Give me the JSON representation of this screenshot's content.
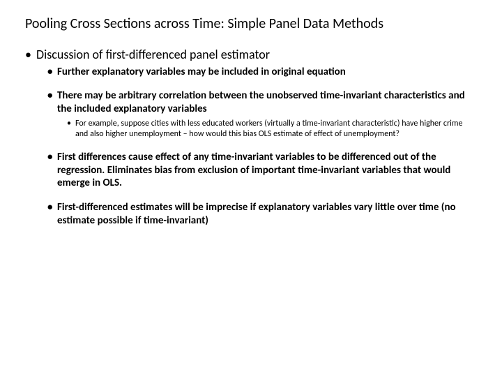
{
  "title": "Pooling Cross Sections across Time: Simple Panel Data Methods",
  "l1": {
    "item1": "Discussion of first-differenced panel estimator"
  },
  "l2": {
    "item1": "Further explanatory variables may be included in original equation",
    "item2": "There may be arbitrary correlation between the unobserved time-invariant characteristics and the included explanatory variables",
    "item3": "First differences cause effect of any time-invariant variables to be differenced out of the regression.   Eliminates bias from exclusion of important time-invariant variables that would emerge in OLS.",
    "item4": "First-differenced estimates will be imprecise if explanatory variables vary little over time (no estimate possible if time-invariant)"
  },
  "l3": {
    "item1": "For example, suppose cities with less educated workers (virtually a time-invariant characteristic) have higher crime and also higher unemployment – how would this bias OLS estimate of effect of unemployment?"
  }
}
